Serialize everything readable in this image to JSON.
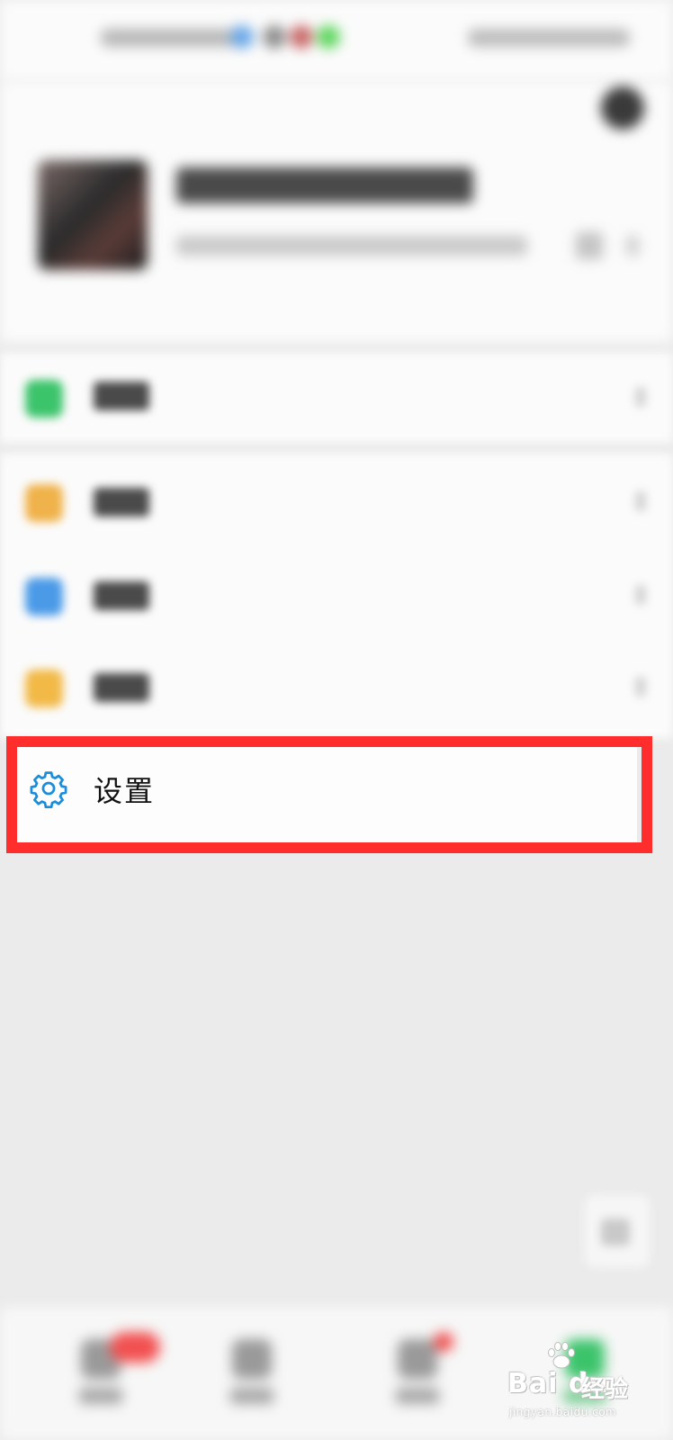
{
  "menu": {
    "settings": {
      "label": "设置",
      "icon": "gear-icon",
      "icon_color": "#1a8ddb"
    }
  },
  "highlight": {
    "color": "#ff2d2b"
  },
  "watermark": {
    "brand": "Bai du",
    "cn": "经验",
    "url": "jingyan.baidu.com"
  },
  "colors": {
    "background": "#ebebeb",
    "card": "#fbfbfb",
    "pay_icon": "#3cc46b",
    "favorites_icon": "#f0b24a",
    "album_icon": "#4a9ae8",
    "stickers_icon": "#f2b946",
    "badge": "#f25050"
  }
}
